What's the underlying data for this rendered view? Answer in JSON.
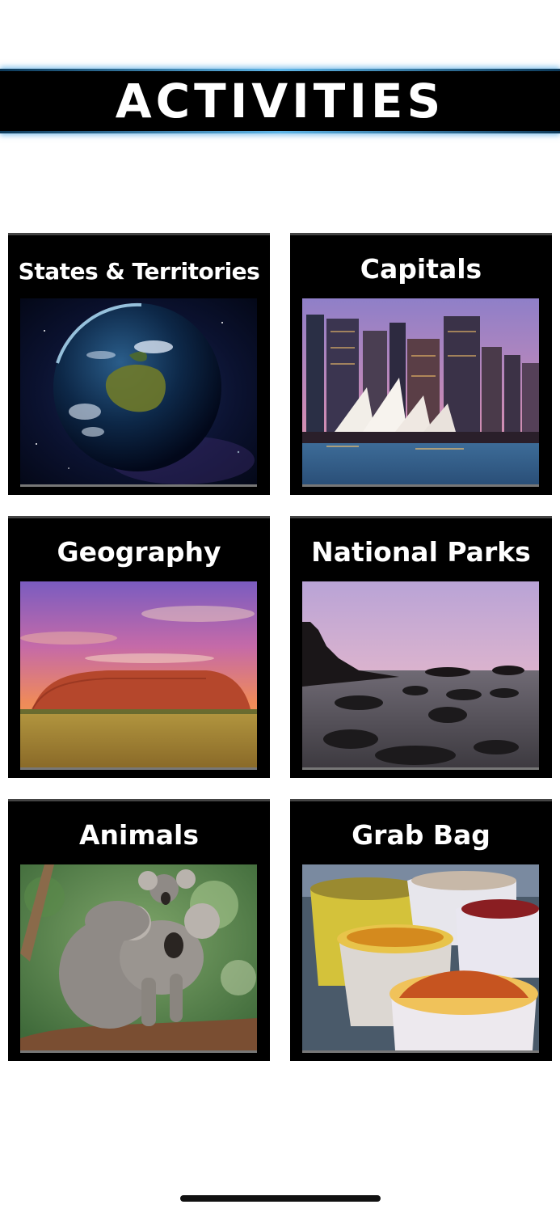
{
  "header": {
    "title": "ACTIVITIES"
  },
  "tiles": [
    {
      "label": "States & Territories",
      "image": "earth-australia-image"
    },
    {
      "label": "Capitals",
      "image": "sydney-opera-house-image"
    },
    {
      "label": "Geography",
      "image": "uluru-sunset-image"
    },
    {
      "label": "National Parks",
      "image": "coastal-rocks-image"
    },
    {
      "label": "Animals",
      "image": "koala-image"
    },
    {
      "label": "Grab Bag",
      "image": "spice-sacks-image"
    }
  ]
}
